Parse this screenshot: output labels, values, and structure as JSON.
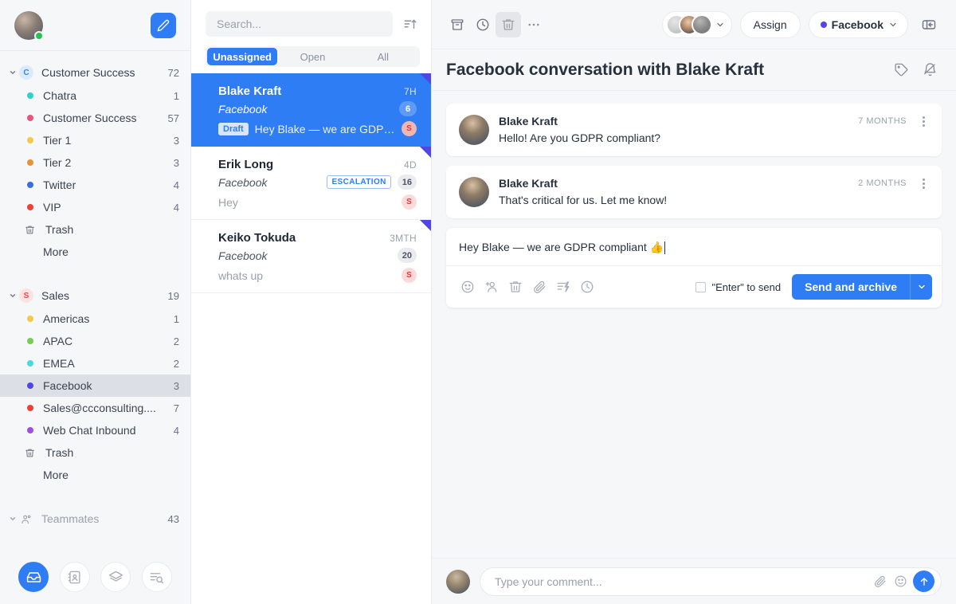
{
  "sidebar": {
    "user_avatar": "user-avatar",
    "online_status": "online",
    "compose_label": "compose-icon",
    "groups": [
      {
        "name": "Customer Success",
        "badge_letter": "C",
        "count": "72",
        "items": [
          {
            "label": "Chatra",
            "count": "1",
            "color": "#2ed3c6"
          },
          {
            "label": "Customer Success",
            "count": "57",
            "color": "#e8547c"
          },
          {
            "label": "Tier 1",
            "count": "3",
            "color": "#f2c94c"
          },
          {
            "label": "Tier 2",
            "count": "3",
            "color": "#e8923a"
          },
          {
            "label": "Twitter",
            "count": "4",
            "color": "#3b6fe0"
          },
          {
            "label": "VIP",
            "count": "4",
            "color": "#ef4036"
          }
        ],
        "trash_label": "Trash",
        "more_label": "More"
      },
      {
        "name": "Sales",
        "badge_letter": "S",
        "count": "19",
        "items": [
          {
            "label": "Americas",
            "count": "1",
            "color": "#f2c94c"
          },
          {
            "label": "APAC",
            "count": "2",
            "color": "#77cc55"
          },
          {
            "label": "EMEA",
            "count": "2",
            "color": "#4ad9e0"
          },
          {
            "label": "Facebook",
            "count": "3",
            "color": "#4f46e5",
            "active": true
          },
          {
            "label": "Sales@ccconsulting....",
            "count": "7",
            "color": "#ef4036"
          },
          {
            "label": "Web Chat Inbound",
            "count": "4",
            "color": "#9b51e0"
          }
        ],
        "trash_label": "Trash",
        "more_label": "More"
      }
    ],
    "teammates": {
      "name": "Teammates",
      "count": "43"
    },
    "nav": [
      {
        "name": "inbox-icon",
        "selected": true
      },
      {
        "name": "contacts-icon",
        "selected": false
      },
      {
        "name": "layers-icon",
        "selected": false
      },
      {
        "name": "reports-search-icon",
        "selected": false
      }
    ]
  },
  "list_pane": {
    "search": {
      "placeholder": "Search...",
      "value": ""
    },
    "sort_icon": "sort-ascending-icon",
    "tabs": [
      {
        "label": "Unassigned",
        "active": true
      },
      {
        "label": "Open",
        "active": false
      },
      {
        "label": "All",
        "active": false
      }
    ],
    "conversations": [
      {
        "name": "Blake Kraft",
        "time": "7H",
        "channel": "Facebook",
        "count": "6",
        "draft_label": "Draft",
        "preview": "Hey Blake — we are GDPR ...",
        "badge": "S",
        "selected": true,
        "tag": ""
      },
      {
        "name": "Erik Long",
        "time": "4D",
        "channel": "Facebook",
        "count": "16",
        "draft_label": "",
        "preview": "Hey",
        "badge": "S",
        "selected": false,
        "tag": "ESCALATION"
      },
      {
        "name": "Keiko Tokuda",
        "time": "3MTH",
        "channel": "Facebook",
        "count": "20",
        "draft_label": "",
        "preview": "whats up",
        "badge": "S",
        "selected": false,
        "tag": ""
      }
    ]
  },
  "main": {
    "toolbar": {
      "archive_icon": "archive-icon",
      "snooze_icon": "clock-icon",
      "trash_icon": "trash-icon",
      "more_icon": "more-horizontal-icon",
      "assign_label": "Assign",
      "channel_label": "Facebook",
      "channel_color": "#4f46e5",
      "panel_toggle_icon": "panel-toggle-icon"
    },
    "conversation_title": "Facebook conversation with Blake Kraft",
    "tag_icon": "tag-icon",
    "mute_icon": "bell-muted-icon",
    "messages": [
      {
        "author": "Blake Kraft",
        "time": "7 MONTHS",
        "text": "Hello! Are you GDPR compliant?"
      },
      {
        "author": "Blake Kraft",
        "time": "2 MONTHS",
        "text": "That's critical for us. Let me know!"
      }
    ],
    "composer": {
      "text": "Hey Blake — we are GDPR compliant 👍",
      "icons": [
        "emoji-icon",
        "add-person-icon",
        "trash-icon",
        "attachment-icon",
        "quick-reply-icon",
        "clock-icon"
      ],
      "enter_to_send_label": "\"Enter\" to send",
      "enter_to_send_checked": false,
      "send_label": "Send and archive",
      "send_caret_icon": "chevron-down-icon"
    },
    "comment_bar": {
      "placeholder": "Type your comment...",
      "value": "",
      "attachment_icon": "attachment-icon",
      "emoji_icon": "emoji-icon",
      "send_icon": "arrow-up-icon"
    }
  },
  "colors": {
    "accent": "#2f7df4",
    "sidebar_bg": "#f6f7f9",
    "indigo": "#4f46e5",
    "online_green": "#23c552",
    "danger": "#e53935"
  }
}
